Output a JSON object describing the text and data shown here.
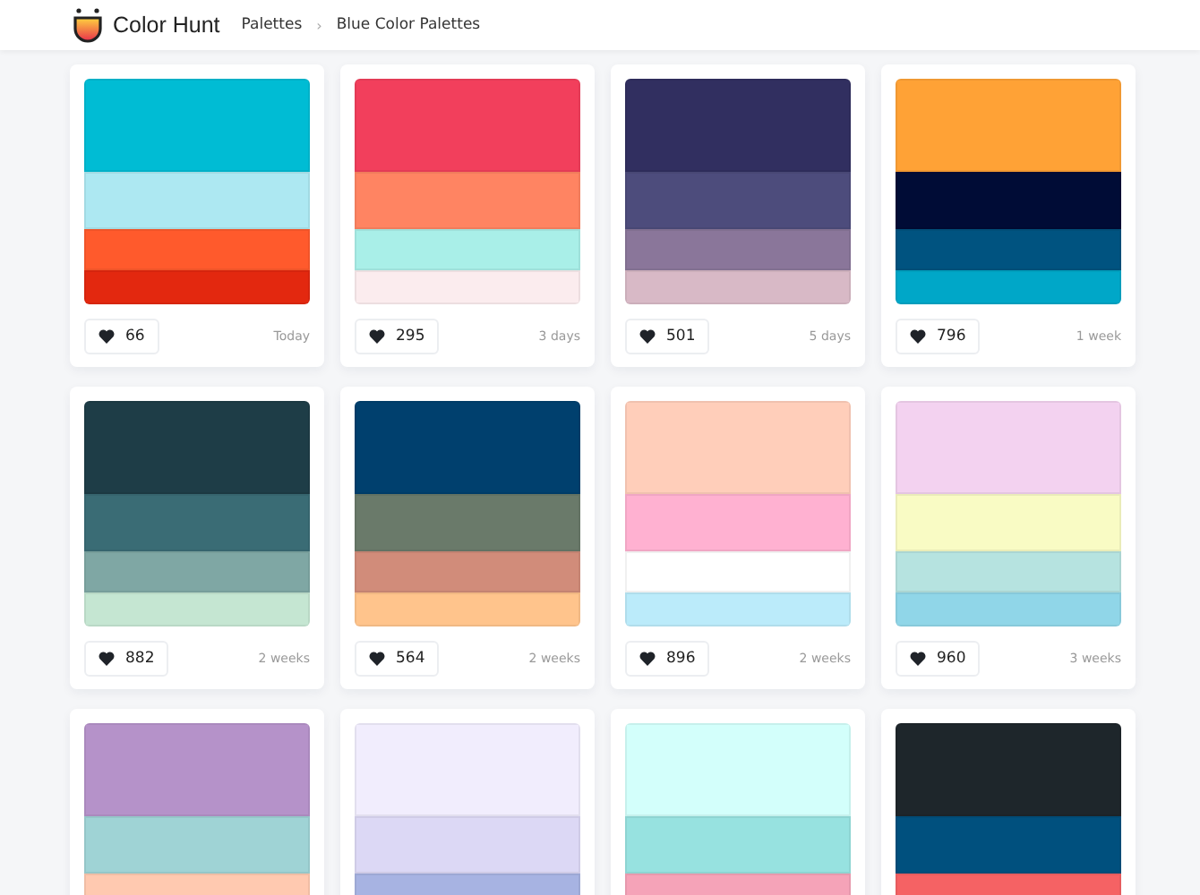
{
  "header": {
    "brand": "Color Hunt",
    "breadcrumb": [
      {
        "label": "Palettes"
      },
      {
        "label": "Blue Color Palettes"
      }
    ],
    "separator": "›"
  },
  "palettes": [
    {
      "colors": [
        {
          "color": "#00bcd4"
        },
        {
          "color": "#ade8f2"
        },
        {
          "color": "#ff5a2c"
        },
        {
          "color": "#e3280f"
        }
      ],
      "likes": "66",
      "time": "Today"
    },
    {
      "colors": [
        {
          "color": "#f23f5c"
        },
        {
          "color": "#ff8462"
        },
        {
          "color": "#a9efe8"
        },
        {
          "color": "#fbecee"
        }
      ],
      "likes": "295",
      "time": "3 days"
    },
    {
      "colors": [
        {
          "color": "#312f60"
        },
        {
          "color": "#4d4c7c"
        },
        {
          "color": "#8a769a"
        },
        {
          "color": "#d8b9c6"
        }
      ],
      "likes": "501",
      "time": "5 days"
    },
    {
      "colors": [
        {
          "color": "#ffa236"
        },
        {
          "color": "#000c36"
        },
        {
          "color": "#005380"
        },
        {
          "color": "#00a7c8"
        }
      ],
      "likes": "796",
      "time": "1 week"
    },
    {
      "colors": [
        {
          "color": "#1e3d47"
        },
        {
          "color": "#3a6c75"
        },
        {
          "color": "#7fa7a4"
        },
        {
          "color": "#c5e6d2"
        }
      ],
      "likes": "882",
      "time": "2 weeks"
    },
    {
      "colors": [
        {
          "color": "#00406e"
        },
        {
          "color": "#6a7a6a"
        },
        {
          "color": "#d18c7a"
        },
        {
          "color": "#ffc48c"
        }
      ],
      "likes": "564",
      "time": "2 weeks"
    },
    {
      "colors": [
        {
          "color": "#ffceba"
        },
        {
          "color": "#ffb1d1"
        },
        {
          "color": "#ffffff"
        },
        {
          "color": "#bbebfa"
        }
      ],
      "likes": "896",
      "time": "2 weeks"
    },
    {
      "colors": [
        {
          "color": "#f3d2f0"
        },
        {
          "color": "#f9fbc4"
        },
        {
          "color": "#b6e3e0"
        },
        {
          "color": "#90d6e8"
        }
      ],
      "likes": "960",
      "time": "3 weeks"
    },
    {
      "colors": [
        {
          "color": "#b592c9"
        },
        {
          "color": "#9fd3d5"
        },
        {
          "color": "#ffc9b0"
        }
      ]
    },
    {
      "colors": [
        {
          "color": "#f1edfd"
        },
        {
          "color": "#dcd8f5"
        },
        {
          "color": "#a7b3e2"
        }
      ]
    },
    {
      "colors": [
        {
          "color": "#d3fffb"
        },
        {
          "color": "#97e2e0"
        },
        {
          "color": "#f5a3b8"
        }
      ]
    },
    {
      "colors": [
        {
          "color": "#1e262b"
        },
        {
          "color": "#00507e"
        },
        {
          "color": "#f56264"
        }
      ]
    }
  ]
}
